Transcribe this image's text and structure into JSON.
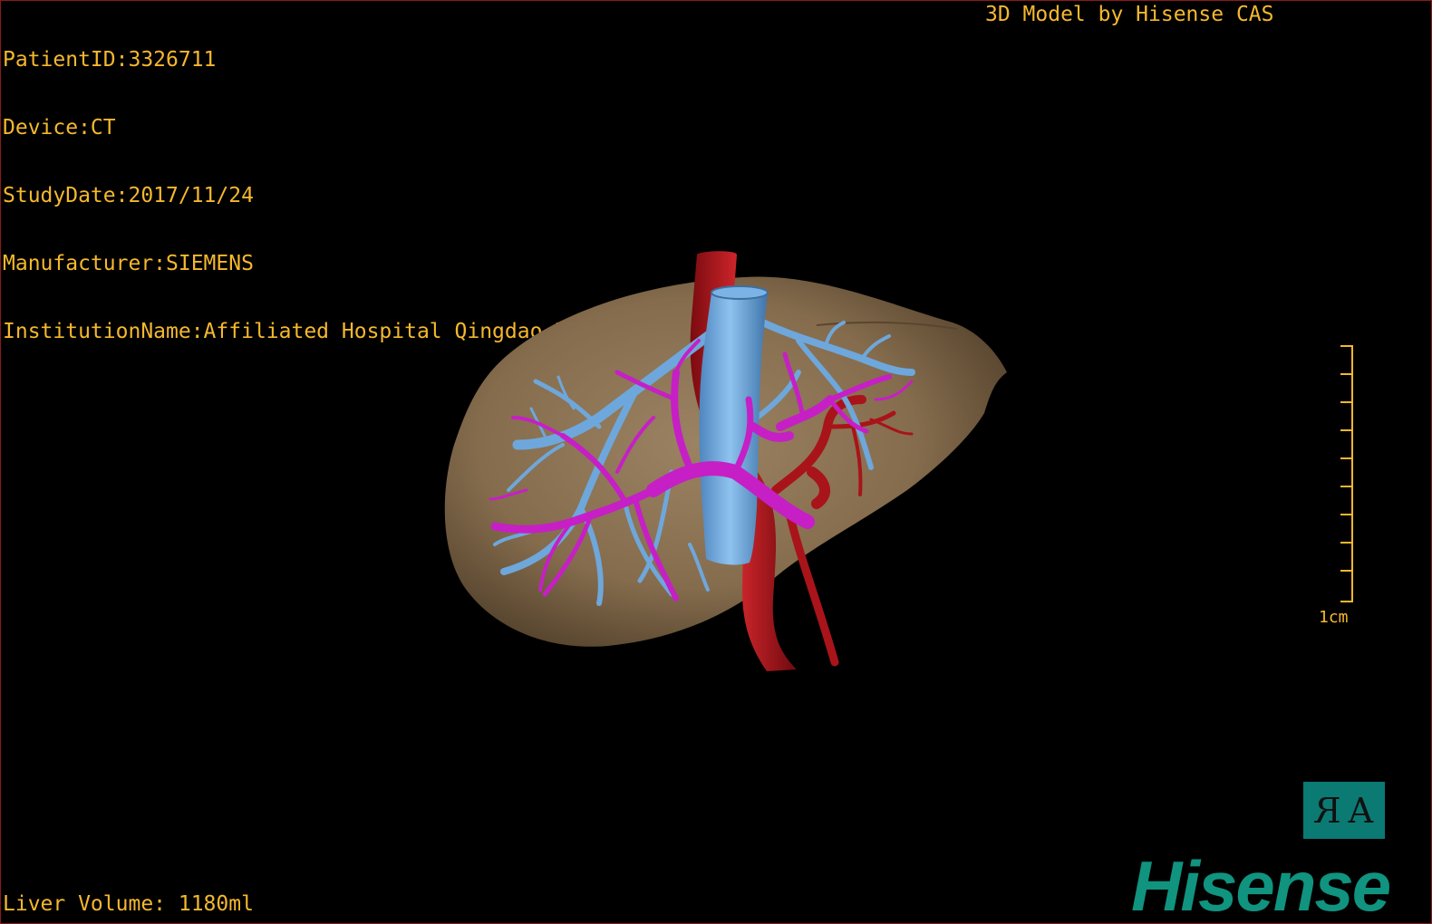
{
  "info": {
    "patient_id": "PatientID:3326711",
    "device": "Device:CT",
    "study_date": "StudyDate:2017/11/24",
    "manufacturer": "Manufacturer:SIEMENS",
    "institution": "InstitutionName:Affiliated Hospital Qingdao University-C"
  },
  "model_label": "3D Model by Hisense CAS",
  "liver_volume": "Liver Volume: 1180ml",
  "scale_bar": {
    "label": "1cm"
  },
  "orientation": {
    "left_glyph": "R",
    "right_glyph": "A"
  },
  "brand": {
    "logo_text": "Hisense"
  },
  "colors": {
    "overlay_text": "#f5b82e",
    "liver": "#8a7150",
    "artery": "#b3121c",
    "vein": "#6fa8dc",
    "portal_vein": "#c81fc8",
    "brand": "#10937f",
    "orientation_box": "#0a7a73"
  },
  "icons": {
    "orientation_cube": "orientation-cube-icon",
    "logo": "hisense-logo"
  }
}
